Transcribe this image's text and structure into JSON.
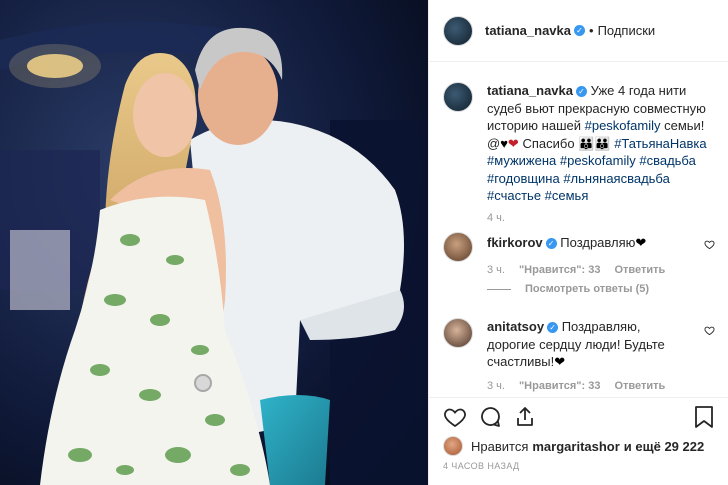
{
  "header": {
    "username": "tatiana_navka",
    "separator": "•",
    "follow_label": "Подписки"
  },
  "caption": {
    "username": "tatiana_navka",
    "text": "Уже 4 года нити судеб вьют прекрасную совместную историю нашей",
    "tag1": "#peskofamily",
    "text2": "семьи! @",
    "emoji_heart": "❤",
    "text3": "Спасибо",
    "tags_line_a": "#ТатьянаНавка",
    "tags_line_b": "#мужижена #peskofamily #свадьба",
    "tags_line_c": "#годовщина #льнянаясвадьба",
    "tags_line_d": "#счастье #семья",
    "age": "4 ч."
  },
  "comments": [
    {
      "username": "fkirkorov",
      "text": "Поздравляю",
      "emoji": "❤",
      "age": "3 ч.",
      "likes": "\"Нравится\": 33",
      "reply": "Ответить",
      "view_replies": "Посмотреть ответы (5)"
    },
    {
      "username": "anitatsoy",
      "text": "Поздравляю, дорогие сердцу люди! Будьте счастливы!",
      "emoji": "❤",
      "age": "3 ч.",
      "likes": "\"Нравится\": 33",
      "reply": "Ответить"
    }
  ],
  "likes": {
    "prefix": "Нравится",
    "user": "margaritashor",
    "suffix": "и ещё 29 222"
  },
  "timestamp": "4 ЧАСОВ НАЗАД",
  "icons": [
    "heart-icon",
    "comment-icon",
    "share-icon",
    "bookmark-icon",
    "verified-badge-icon"
  ],
  "colors": {
    "accent": "#3897f0",
    "hashtag": "#003569",
    "muted": "#999999"
  }
}
